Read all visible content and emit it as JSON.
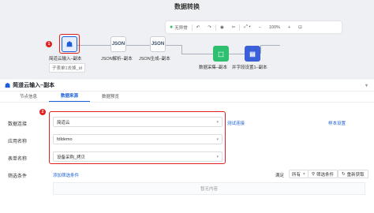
{
  "canvas": {
    "title": "数据转换",
    "nodes": [
      {
        "label": "简道云输入–副本",
        "sublabel": "子表单1去掉_id",
        "icon": "jiandaoyun-input-icon"
      },
      {
        "label": "JSON解析–副本",
        "badge": "JSON"
      },
      {
        "label": "JSON生成–副本",
        "badge": "JSON"
      },
      {
        "label": "数据采集–副本",
        "icon": "data-collect-icon"
      },
      {
        "label": "并字段设置1–副本",
        "icon": "field-setting-icon"
      }
    ],
    "annotation_1": "1"
  },
  "toolbar": {
    "status": "无异常",
    "zoom": "100%"
  },
  "panel": {
    "title": "简道云输入–副本",
    "tabs": [
      "节点信息",
      "数据来源",
      "数据预览"
    ],
    "active_tab": 1,
    "annotation_2": "2",
    "rows": {
      "connection_label": "数据连接",
      "connection_value": "简道云",
      "test_link": "测试连接",
      "settings_link": "样本设置",
      "app_label": "应用名称",
      "app_value": "fdldemo",
      "form_label": "表单名称",
      "form_value": "设备采购_拷贝"
    },
    "filter": {
      "label": "筛选条件",
      "add_link": "添加筛选条件",
      "satisfy_label": "满足",
      "satisfy_value": "所有",
      "filter_button": "筛选条件",
      "refresh_button": "重新获取",
      "empty": "暂无内容"
    }
  },
  "colors": {
    "accent": "#1b5fd9",
    "annotation": "#e02020",
    "status_ok": "#2fbf71"
  }
}
